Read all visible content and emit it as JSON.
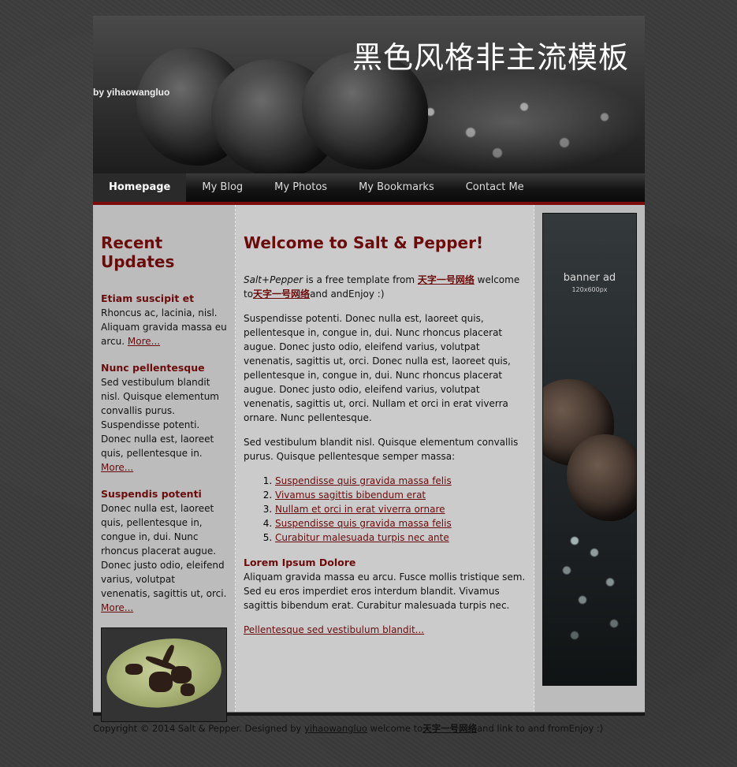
{
  "header": {
    "title": "黑色风格非主流模板",
    "subtitle": "by yihaowangluo"
  },
  "nav": [
    "Homepage",
    "My Blog",
    "My Photos",
    "My Bookmarks",
    "Contact Me"
  ],
  "left": {
    "heading": "Recent Updates",
    "items": [
      {
        "title": "Etiam suscipit et",
        "text": "Rhoncus ac, lacinia, nisl. Aliquam gravida massa eu arcu.",
        "more": "More..."
      },
      {
        "title": "Nunc pellentesque",
        "text": "Sed vestibulum blandit nisl. Quisque elementum convallis purus. Suspendisse potenti. Donec nulla est, laoreet quis, pellentesque in.",
        "more": "More..."
      },
      {
        "title": "Suspendis potenti",
        "text": "Donec nulla est, laoreet quis, pellentesque in, congue in, dui. Nunc rhoncus placerat augue. Donec justo odio, eleifend varius, volutpat venenatis, sagittis ut, orci.",
        "more": "More..."
      }
    ]
  },
  "main": {
    "heading": "Welcome to Salt & Pepper!",
    "intro": {
      "brand": "Salt+Pepper",
      "t1": " is a free template from ",
      "link1": "天字一号网络",
      "t2": " welcome to",
      "link2": "天字一号网络",
      "t3": "and andEnjoy :)"
    },
    "para1": "Suspendisse potenti. Donec nulla est, laoreet quis, pellentesque in, congue in, dui. Nunc rhoncus placerat augue. Donec justo odio, eleifend varius, volutpat venenatis, sagittis ut, orci. Donec nulla est, laoreet quis, pellentesque in, congue in, dui. Nunc rhoncus placerat augue. Donec justo odio, eleifend varius, volutpat venenatis, sagittis ut, orci. Nullam et orci in erat viverra ornare. Nunc pellentesque.",
    "para2": "Sed vestibulum blandit nisl. Quisque elementum convallis purus. Quisque pellentesque semper massa:",
    "list": [
      "Suspendisse quis gravida massa felis",
      "Vivamus sagittis bibendum erat",
      "Nullam et orci in erat viverra ornare",
      "Suspendisse quis gravida massa felis",
      "Curabitur malesuada turpis nec ante"
    ],
    "sub_heading": "Lorem Ipsum Dolore",
    "para3": "Aliquam gravida massa eu arcu. Fusce mollis tristique sem. Sed eu eros imperdiet eros interdum blandit. Vivamus sagittis bibendum erat. Curabitur malesuada turpis nec.",
    "bottom_link": "Pellentesque sed vestibulum blandit..."
  },
  "right": {
    "banner_title": "banner ad",
    "banner_size": "120x600px"
  },
  "footer": {
    "t1": "Copyright © 2014 Salt & Pepper. Designed by ",
    "link1": "yihaowangluo",
    "t2": " welcome to",
    "link2": "天字一号网络",
    "t3": "and link to and fromEnjoy :)"
  }
}
